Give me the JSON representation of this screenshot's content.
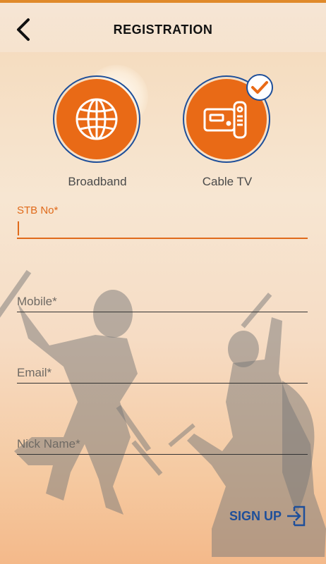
{
  "header": {
    "title": "REGISTRATION"
  },
  "services": [
    {
      "label": "Broadband",
      "selected": false,
      "icon": "globe-icon"
    },
    {
      "label": "Cable TV",
      "selected": true,
      "icon": "settop-box-remote-icon"
    }
  ],
  "form": {
    "stb": {
      "label": "STB No*",
      "value": ""
    },
    "mobile": {
      "placeholder": "Mobile*",
      "value": ""
    },
    "email": {
      "placeholder": "Email*",
      "value": ""
    },
    "nickname": {
      "placeholder": "Nick Name*",
      "value": ""
    }
  },
  "actions": {
    "signup_label": "SIGN UP"
  },
  "colors": {
    "accent": "#e96a16",
    "primary_blue": "#1e4f9a",
    "header_stripe": "#e08a2a"
  }
}
